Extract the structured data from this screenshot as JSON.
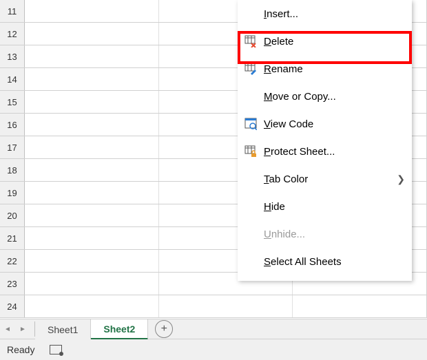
{
  "rows": [
    11,
    12,
    13,
    14,
    15,
    16,
    17,
    18,
    19,
    20,
    21,
    22,
    23,
    24
  ],
  "tabs": {
    "nav_prev": "◄",
    "nav_next": "►",
    "items": [
      {
        "label": "Sheet1",
        "active": false
      },
      {
        "label": "Sheet2",
        "active": true
      }
    ],
    "add": "+"
  },
  "status": {
    "ready": "Ready"
  },
  "context_menu": {
    "items": [
      {
        "key": "insert",
        "label": "Insert...",
        "accel": "I",
        "icon": null,
        "disabled": false,
        "arrow": false
      },
      {
        "key": "delete",
        "label": "Delete",
        "accel": "D",
        "icon": "delete-sheet-icon",
        "disabled": false,
        "arrow": false,
        "highlighted": true
      },
      {
        "key": "rename",
        "label": "Rename",
        "accel": "R",
        "icon": "rename-sheet-icon",
        "disabled": false,
        "arrow": false
      },
      {
        "key": "move",
        "label": "Move or Copy...",
        "accel": "M",
        "icon": null,
        "disabled": false,
        "arrow": false
      },
      {
        "key": "viewcode",
        "label": "View Code",
        "accel": "V",
        "icon": "view-code-icon",
        "disabled": false,
        "arrow": false
      },
      {
        "key": "protect",
        "label": "Protect Sheet...",
        "accel": "P",
        "icon": "protect-sheet-icon",
        "disabled": false,
        "arrow": false
      },
      {
        "key": "tabcolor",
        "label": "Tab Color",
        "accel": "T",
        "icon": null,
        "disabled": false,
        "arrow": true
      },
      {
        "key": "hide",
        "label": "Hide",
        "accel": "H",
        "icon": null,
        "disabled": false,
        "arrow": false
      },
      {
        "key": "unhide",
        "label": "Unhide...",
        "accel": "U",
        "icon": null,
        "disabled": true,
        "arrow": false
      },
      {
        "key": "selectall",
        "label": "Select All Sheets",
        "accel": "S",
        "icon": null,
        "disabled": false,
        "arrow": false
      }
    ]
  }
}
